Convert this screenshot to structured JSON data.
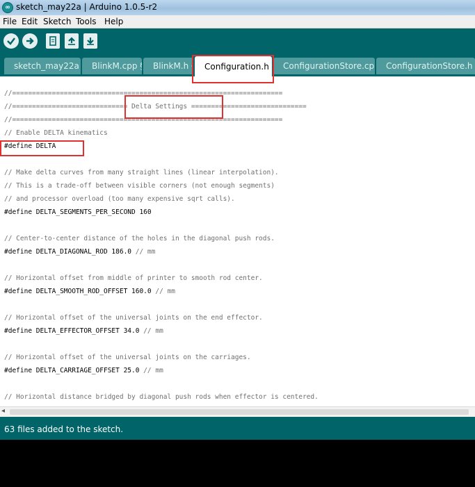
{
  "window": {
    "title": "sketch_may22a | Arduino 1.0.5-r2"
  },
  "menu": [
    "File",
    "Edit",
    "Sketch",
    "Tools",
    "Help"
  ],
  "toolbar": {
    "buttons": [
      {
        "name": "verify",
        "icon": "check-icon"
      },
      {
        "name": "upload",
        "icon": "arrow-right-icon"
      },
      {
        "name": "new",
        "icon": "new-file-icon"
      },
      {
        "name": "open",
        "icon": "arrow-up-icon"
      },
      {
        "name": "save",
        "icon": "arrow-down-icon"
      }
    ]
  },
  "tabs": [
    {
      "label": "sketch_may22a",
      "active": false
    },
    {
      "label": "BlinkM.cpp §",
      "active": false
    },
    {
      "label": "BlinkM.h §",
      "active": false
    },
    {
      "label": "Configuration.h",
      "active": true
    },
    {
      "label": "ConfigurationStore.cpp",
      "active": false
    },
    {
      "label": "ConfigurationStore.h §",
      "active": false
    }
  ],
  "code": [
    {
      "kw": "",
      "cm": "//===================================================================="
    },
    {
      "kw": "",
      "cm": "//============================= Delta Settings ============================="
    },
    {
      "kw": "",
      "cm": "//===================================================================="
    },
    {
      "kw": "",
      "cm": "// Enable DELTA kinematics"
    },
    {
      "kw": "#define DELTA",
      "cm": ""
    },
    {
      "kw": "",
      "cm": ""
    },
    {
      "kw": "",
      "cm": "// Make delta curves from many straight lines (linear interpolation)."
    },
    {
      "kw": "",
      "cm": "// This is a trade-off between visible corners (not enough segments)"
    },
    {
      "kw": "",
      "cm": "// and processor overload (too many expensive sqrt calls)."
    },
    {
      "kw": "#define DELTA_SEGMENTS_PER_SECOND 160",
      "cm": ""
    },
    {
      "kw": "",
      "cm": ""
    },
    {
      "kw": "",
      "cm": "// Center-to-center distance of the holes in the diagonal push rods."
    },
    {
      "kw": "#define DELTA_DIAGONAL_ROD 186.0",
      "cm": " // mm"
    },
    {
      "kw": "",
      "cm": ""
    },
    {
      "kw": "",
      "cm": "// Horizontal offset from middle of printer to smooth rod center."
    },
    {
      "kw": "#define DELTA_SMOOTH_ROD_OFFSET 160.0",
      "cm": " // mm"
    },
    {
      "kw": "",
      "cm": ""
    },
    {
      "kw": "",
      "cm": "// Horizontal offset of the universal joints on the end effector."
    },
    {
      "kw": "#define DELTA_EFFECTOR_OFFSET 34.0",
      "cm": " // mm"
    },
    {
      "kw": "",
      "cm": ""
    },
    {
      "kw": "",
      "cm": "// Horizontal offset of the universal joints on the carriages."
    },
    {
      "kw": "#define DELTA_CARRIAGE_OFFSET 25.0",
      "cm": " // mm"
    },
    {
      "kw": "",
      "cm": ""
    },
    {
      "kw": "",
      "cm": "// Horizontal distance bridged by diagonal push rods when effector is centered."
    }
  ],
  "status": {
    "message": "63 files added to the sketch."
  },
  "colors": {
    "teal": "#006468",
    "tab": "#4f9a9c",
    "highlight": "#e0302f"
  }
}
